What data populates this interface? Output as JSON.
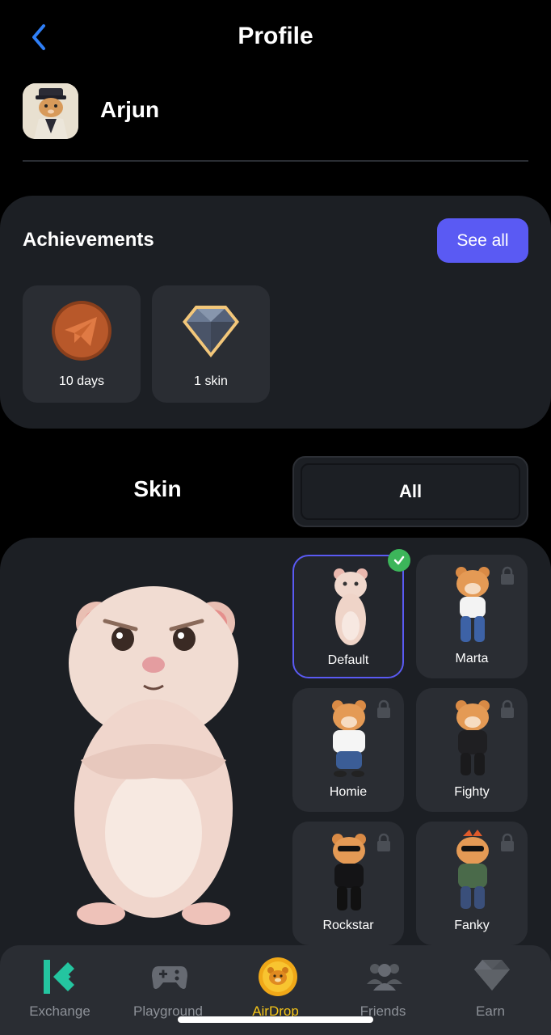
{
  "header": {
    "title": "Profile",
    "back_icon": "chevron-left-icon"
  },
  "user": {
    "name": "Arjun"
  },
  "achievements": {
    "title": "Achievements",
    "see_all_label": "See all",
    "items": [
      {
        "label": "10 days",
        "icon": "telegram-badge-icon"
      },
      {
        "label": "1 skin",
        "icon": "diamond-badge-icon"
      }
    ]
  },
  "skins": {
    "section_label": "Skin",
    "filter_label": "All",
    "items": [
      {
        "name": "Default",
        "selected": true,
        "locked": false
      },
      {
        "name": "Marta",
        "selected": false,
        "locked": true
      },
      {
        "name": "Homie",
        "selected": false,
        "locked": true
      },
      {
        "name": "Fighty",
        "selected": false,
        "locked": true
      },
      {
        "name": "Rockstar",
        "selected": false,
        "locked": true
      },
      {
        "name": "Fanky",
        "selected": false,
        "locked": true
      }
    ]
  },
  "nav": {
    "items": [
      {
        "label": "Exchange",
        "icon": "exchange-logo-icon"
      },
      {
        "label": "Playground",
        "icon": "gamepad-icon"
      },
      {
        "label": "AirDrop",
        "icon": "hamster-coin-icon",
        "active": true
      },
      {
        "label": "Friends",
        "icon": "friends-icon"
      },
      {
        "label": "Earn",
        "icon": "diamond-icon"
      }
    ]
  },
  "colors": {
    "accent": "#5a5af3",
    "active_nav": "#f5c518",
    "check": "#3cb55a",
    "panel": "#1c1f24",
    "card": "#2a2d33"
  }
}
